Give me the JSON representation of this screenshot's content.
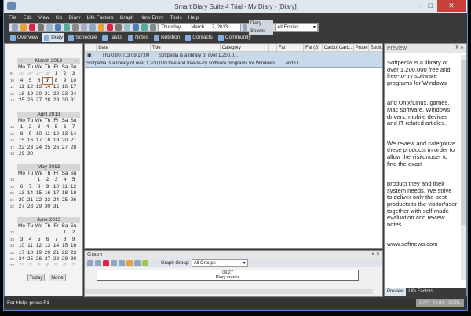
{
  "window": {
    "title": "Smart Diary Suite 4 Trial - My Diary - [Diary]",
    "minimize": "–",
    "maximize": "□",
    "close": "✕"
  },
  "menu": [
    "File",
    "Edit",
    "View",
    "Go",
    "Diary",
    "Life Factors",
    "Graph",
    "New Entry",
    "Tools",
    "Help"
  ],
  "toolbar": {
    "date": {
      "weekday": "Thursday ,",
      "month": "March",
      "day": "7, 2013"
    },
    "diary_shows_label": "Diary Shows:",
    "diary_shows_value": "All Entries"
  },
  "tabs": [
    {
      "label": "Overview"
    },
    {
      "label": "Diary",
      "active": true
    },
    {
      "label": "Schedule"
    },
    {
      "label": "Tasks"
    },
    {
      "label": "Notes"
    },
    {
      "label": "Nutrition"
    },
    {
      "label": "Contacts"
    },
    {
      "label": "Community"
    }
  ],
  "calendar": {
    "dows": [
      "Mo",
      "Tu",
      "We",
      "Th",
      "Fr",
      "Sa",
      "Su"
    ],
    "today_label": "Today",
    "none_label": "None",
    "months": [
      {
        "title": "March 2013",
        "weeks": [
          [
            "9",
            "25*",
            "26*",
            "27*",
            "28*",
            "1",
            "2",
            "3"
          ],
          [
            "10",
            "4",
            "5",
            "6",
            "7!",
            "8",
            "9",
            "10"
          ],
          [
            "11",
            "11",
            "12",
            "13",
            "14",
            "15",
            "16",
            "17"
          ],
          [
            "12",
            "18",
            "19",
            "20",
            "21",
            "22",
            "23",
            "24"
          ],
          [
            "13",
            "25",
            "26",
            "27",
            "28",
            "29",
            "30",
            "31"
          ]
        ]
      },
      {
        "title": "April 2013",
        "weeks": [
          [
            "14",
            "1",
            "2",
            "3",
            "4",
            "5",
            "6",
            "7"
          ],
          [
            "15",
            "8",
            "9",
            "10",
            "11",
            "12",
            "13",
            "14"
          ],
          [
            "16",
            "15",
            "16",
            "17",
            "18",
            "19",
            "20",
            "21"
          ],
          [
            "17",
            "22",
            "23",
            "24",
            "25",
            "26",
            "27",
            "28"
          ],
          [
            "18",
            "29",
            "30",
            "",
            "",
            "",
            "",
            ""
          ]
        ]
      },
      {
        "title": "May 2013",
        "weeks": [
          [
            "18",
            "",
            "",
            "1",
            "2",
            "3",
            "4",
            "5"
          ],
          [
            "19",
            "6",
            "7",
            "8",
            "9",
            "10",
            "11",
            "12"
          ],
          [
            "20",
            "13",
            "14",
            "15",
            "16",
            "17",
            "18",
            "19"
          ],
          [
            "21",
            "20",
            "21",
            "22",
            "23",
            "24",
            "25",
            "26"
          ],
          [
            "22",
            "27",
            "28",
            "29",
            "30",
            "31",
            "",
            ""
          ]
        ]
      },
      {
        "title": "June 2013",
        "weeks": [
          [
            "22",
            "",
            "",
            "",
            "",
            "",
            "1",
            "2"
          ],
          [
            "23",
            "3",
            "4",
            "5",
            "6",
            "7",
            "8",
            "9"
          ],
          [
            "24",
            "10",
            "11",
            "12",
            "13",
            "14",
            "15",
            "16"
          ],
          [
            "25",
            "17",
            "18",
            "19",
            "20",
            "21",
            "22",
            "23"
          ],
          [
            "26",
            "24",
            "25",
            "26",
            "27",
            "28",
            "29",
            "30"
          ],
          [
            "27",
            "1*",
            "2*",
            "3*",
            "4*",
            "5*",
            "6*",
            "7*"
          ]
        ]
      }
    ]
  },
  "grid": {
    "columns": [
      "",
      "Date",
      "Title",
      "Category",
      "",
      "Fat",
      "Fat (S)",
      "Carbo",
      "Carb...",
      "Protein",
      "Sodiu..."
    ],
    "rows": [
      {
        "date": "Thu 03/07/13 09:27:00",
        "title": "Softpedia is a library of over 1,200,0...",
        "body": "Softpedia is a library of over 1,200,000 free and free-to-try software programs for Windows        and U"
      }
    ]
  },
  "graph": {
    "title": "Graph",
    "group_label": "Graph Group:",
    "group_value": "All Groups",
    "time": "09:27",
    "caption": "Diary entries"
  },
  "preview": {
    "title": "Preview",
    "paragraphs": [
      "Softpedia is a library of over 1,200,000 free and free-to-try software programs for Windows",
      "and Unix/Linux, games, Mac software, Windows drivers, mobile devices and IT-related articles.",
      "We review and categorize these products in order to allow the visitor/user to find the exact",
      "product they and their system needs. We strive to deliver only the best products to the visitor/user together with self-made evaluation and review notes.",
      "www.softnews.com"
    ],
    "tabs": [
      "Preview",
      "Life Factors"
    ]
  },
  "status": {
    "text": "For Help, press F1",
    "indicators": "CAP NUM SCRL"
  }
}
